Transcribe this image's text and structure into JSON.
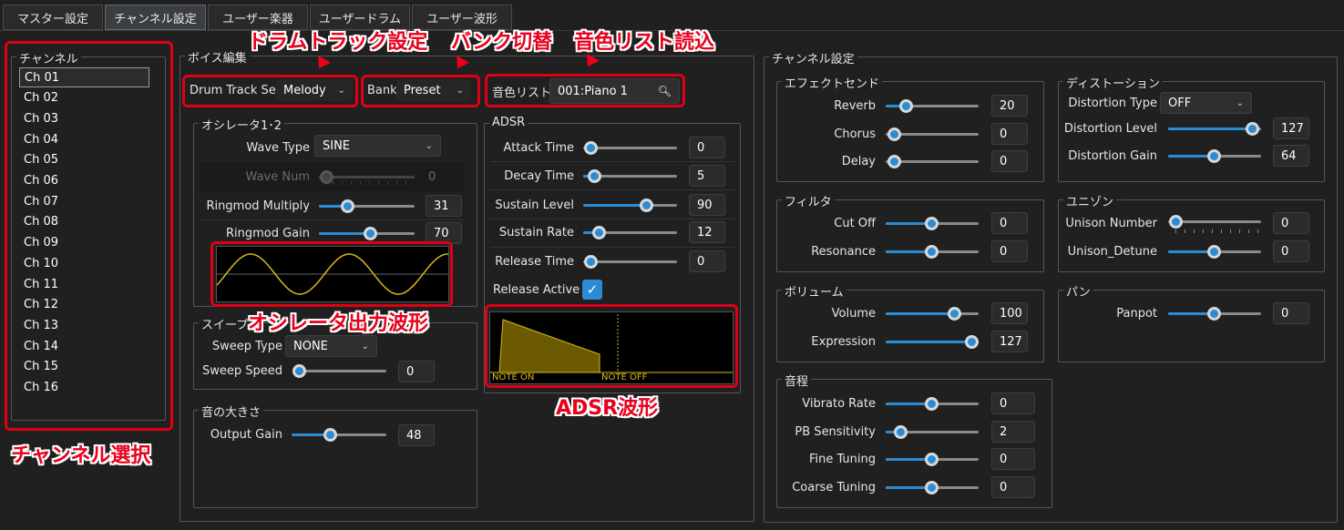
{
  "tabs": [
    {
      "label": "マスター設定"
    },
    {
      "label": "チャンネル設定"
    },
    {
      "label": "ユーザー楽器"
    },
    {
      "label": "ユーザードラム"
    },
    {
      "label": "ユーザー波形"
    }
  ],
  "channel_panel": {
    "title": "チャンネル",
    "items": [
      "Ch 01",
      "Ch 02",
      "Ch 03",
      "Ch 04",
      "Ch 05",
      "Ch 06",
      "Ch 07",
      "Ch 08",
      "Ch 09",
      "Ch 10",
      "Ch 11",
      "Ch 12",
      "Ch 13",
      "Ch 14",
      "Ch 15",
      "Ch 16"
    ]
  },
  "voice": {
    "title": "ボイス編集",
    "drum_label": "Drum Track Set",
    "drum_value": "Melody",
    "bank_label": "Bank",
    "bank_value": "Preset",
    "tone_label": "音色リスト",
    "tone_value": "001:Piano 1"
  },
  "osc": {
    "title": "オシレータ1･2",
    "wave_type_label": "Wave Type",
    "wave_type_value": "SINE",
    "wave_num_label": "Wave Num",
    "wave_num_value": "0",
    "ringmod_mult_label": "Ringmod Multiply",
    "ringmod_mult_value": "31",
    "ringmod_gain_label": "Ringmod Gain",
    "ringmod_gain_value": "70"
  },
  "sweep": {
    "title": "スイープ",
    "type_label": "Sweep Type",
    "type_value": "NONE",
    "speed_label": "Sweep Speed",
    "speed_value": "0"
  },
  "volume_group": {
    "title": "音の大きさ",
    "gain_label": "Output Gain",
    "gain_value": "48"
  },
  "adsr": {
    "title": "ADSR",
    "attack_label": "Attack Time",
    "attack_value": "0",
    "decay_label": "Decay Time",
    "decay_value": "5",
    "sustain_level_label": "Sustain Level",
    "sustain_level_value": "90",
    "sustain_rate_label": "Sustain Rate",
    "sustain_rate_value": "12",
    "release_label": "Release Time",
    "release_value": "0",
    "release_active_label": "Release Active",
    "note_on": "NOTE ON",
    "note_off": "NOTE OFF"
  },
  "ch_settings": {
    "title": "チャンネル設定",
    "effect": {
      "title": "エフェクトセンド",
      "reverb_label": "Reverb",
      "reverb_value": "20",
      "chorus_label": "Chorus",
      "chorus_value": "0",
      "delay_label": "Delay",
      "delay_value": "0"
    },
    "distortion": {
      "title": "ディストーション",
      "type_label": "Distortion Type",
      "type_value": "OFF",
      "level_label": "Distortion Level",
      "level_value": "127",
      "gain_label": "Distortion Gain",
      "gain_value": "64"
    },
    "filter": {
      "title": "フィルタ",
      "cutoff_label": "Cut Off",
      "cutoff_value": "0",
      "res_label": "Resonance",
      "res_value": "0"
    },
    "unison": {
      "title": "ユニゾン",
      "number_label": "Unison Number",
      "number_value": "0",
      "detune_label": "Unison_Detune",
      "detune_value": "0"
    },
    "volume": {
      "title": "ボリューム",
      "volume_label": "Volume",
      "volume_value": "100",
      "expression_label": "Expression",
      "expression_value": "127"
    },
    "pan": {
      "title": "パン",
      "panpot_label": "Panpot",
      "panpot_value": "0"
    },
    "pitch": {
      "title": "音程",
      "vibrato_label": "Vibrato Rate",
      "vibrato_value": "0",
      "pb_label": "PB Sensitivity",
      "pb_value": "2",
      "fine_label": "Fine Tuning",
      "fine_value": "0",
      "coarse_label": "Coarse Tuning",
      "coarse_value": "0"
    }
  },
  "annotations": {
    "drum": "ドラムトラック設定",
    "bank": "バンク切替",
    "tone": "音色リスト読込",
    "osc_wave": "オシレータ出力波形",
    "adsr_wave": "ADSR波形",
    "channel_select": "チャンネル選択"
  },
  "accent_color": "#2b8cd6",
  "annotation_color": "#e8001c"
}
